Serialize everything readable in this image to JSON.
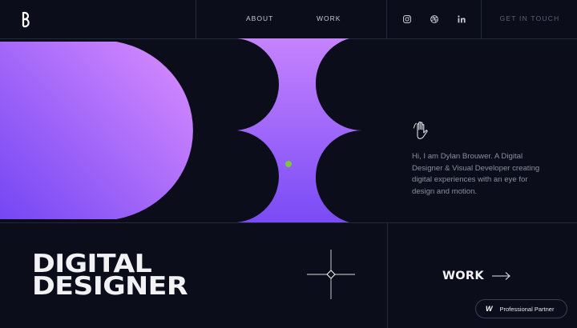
{
  "nav": {
    "logo": "logo-b",
    "links": [
      {
        "label": "ABOUT"
      },
      {
        "label": "WORK"
      }
    ],
    "social": [
      {
        "icon": "instagram-icon"
      },
      {
        "icon": "dribbble-icon"
      },
      {
        "icon": "linkedin-icon"
      }
    ],
    "cta_label": "GET IN TOUCH"
  },
  "hero": {
    "intro": "Hi, I am Dylan Brouwer. A Digital Designer & Visual Developer creating digital experiences with an eye for design and motion.",
    "headline_line1": "DIGITAL",
    "headline_line2": "DESIGNER",
    "work_label": "WORK"
  },
  "badge": {
    "mark": "W",
    "label": "Professional Partner"
  },
  "colors": {
    "background": "#0b0e1a",
    "gradient_light": "#d68bff",
    "gradient_dark": "#7446f3",
    "dot": "#7cc63a",
    "grid_line": "#23283a"
  }
}
